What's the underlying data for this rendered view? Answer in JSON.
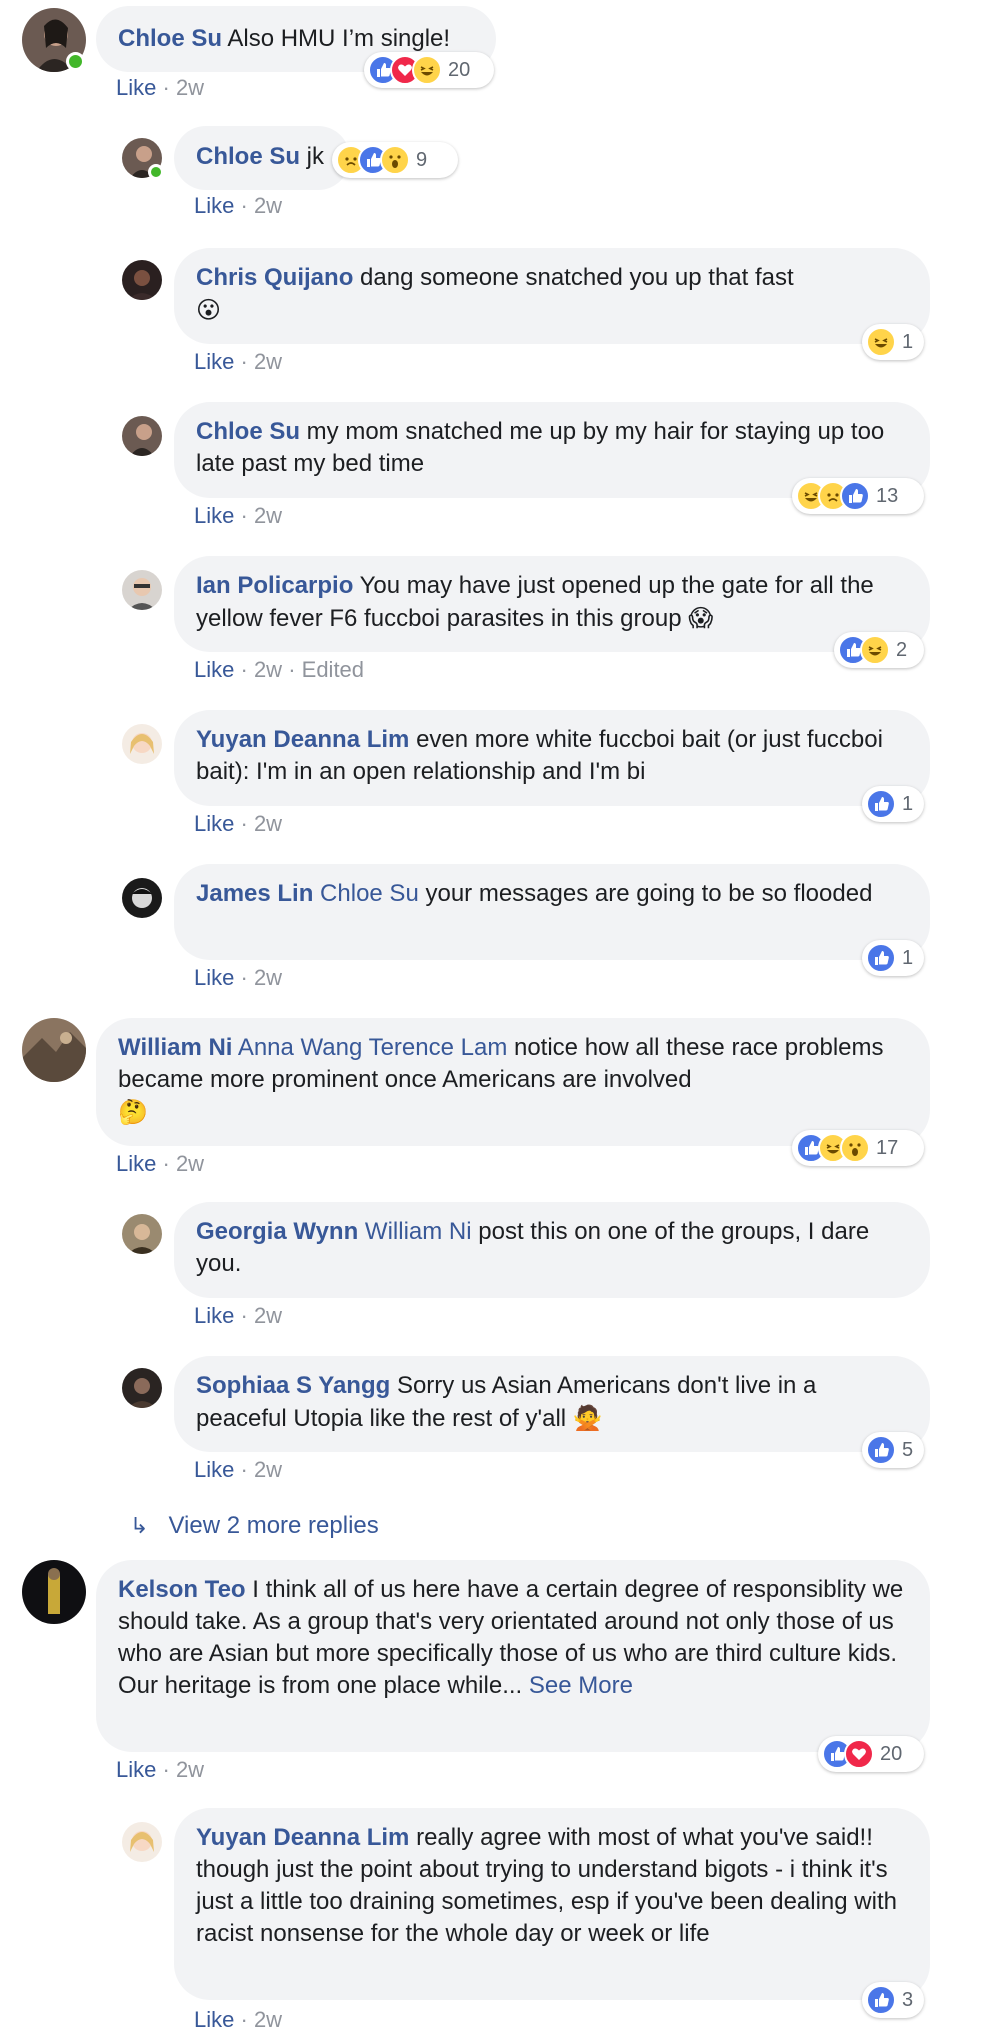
{
  "comments": [
    {
      "name": "Chloe Su",
      "text": " Also HMU I’m single!",
      "meta_time": "2w",
      "reaction_count": "20"
    },
    {
      "name": "Chloe Su",
      "text": " jk",
      "meta_time": "2w",
      "reaction_count": "9"
    },
    {
      "name": "Chris Quijano",
      "text": " dang someone snatched you up that fast",
      "emoji": "😮",
      "meta_time": "2w",
      "reaction_count": "1"
    },
    {
      "name": "Chloe Su",
      "text": " my mom snatched me up by my hair for staying up too late past my bed time",
      "meta_time": "2w",
      "reaction_count": "13"
    },
    {
      "name": "Ian Policarpio",
      "text": " You may have just opened up the gate for all the yellow fever F6 fuccboi parasites in this group ",
      "emoji": "😱",
      "meta_time": "2w",
      "meta_edited": "Edited",
      "reaction_count": "2"
    },
    {
      "name": "Yuyan Deanna Lim",
      "text": " even more white fuccboi bait (or just fuccboi bait): I'm in an open relationship and I'm bi",
      "meta_time": "2w",
      "reaction_count": "1"
    },
    {
      "name": "James Lin",
      "mention": " Chloe Su",
      "text": " your messages are going to be so flooded",
      "meta_time": "2w",
      "reaction_count": "1"
    },
    {
      "name": "William Ni",
      "mention": " Anna Wang Terence Lam",
      "text": " notice how all these race problems became more prominent once Americans are involved",
      "emoji": "🤔",
      "meta_time": "2w",
      "reaction_count": "17"
    },
    {
      "name": "Georgia Wynn",
      "mention": " William Ni",
      "text": " post this on one of the groups, I dare you.",
      "meta_time": "2w"
    },
    {
      "name": "Sophiaa S Yangg",
      "text": " Sorry us Asian Americans don't live in a peaceful Utopia like the rest of y'all ",
      "emoji": "🙅",
      "meta_time": "2w",
      "reaction_count": "5"
    },
    {
      "name": "Kelson Teo",
      "text": " I think all of us here have a certain degree of responsiblity we should take. As a group that's very orientated around not only those of us who are Asian but more specifically those of us who are third culture kids. Our heritage is from one place while... ",
      "see_more": "See More",
      "meta_time": "2w",
      "reaction_count": "20"
    },
    {
      "name": "Yuyan Deanna Lim",
      "text": " really agree with most of what you've said!! though just the point about trying to understand bigots - i think it's just a little too draining sometimes, esp if you've been dealing with racist nonsense for the whole day or week or life",
      "meta_time": "2w",
      "reaction_count": "3"
    }
  ],
  "like_label": "Like",
  "meta_separator": "·",
  "view_more": "View 2 more replies",
  "colors": {
    "name_link": "#385898",
    "bubble_bg": "#f2f3f5",
    "meta_text": "#90949c",
    "like_reaction": "#4a76e8",
    "love_reaction": "#f0284a",
    "haha_reaction": "#ffd44a",
    "online": "#42b72a"
  }
}
